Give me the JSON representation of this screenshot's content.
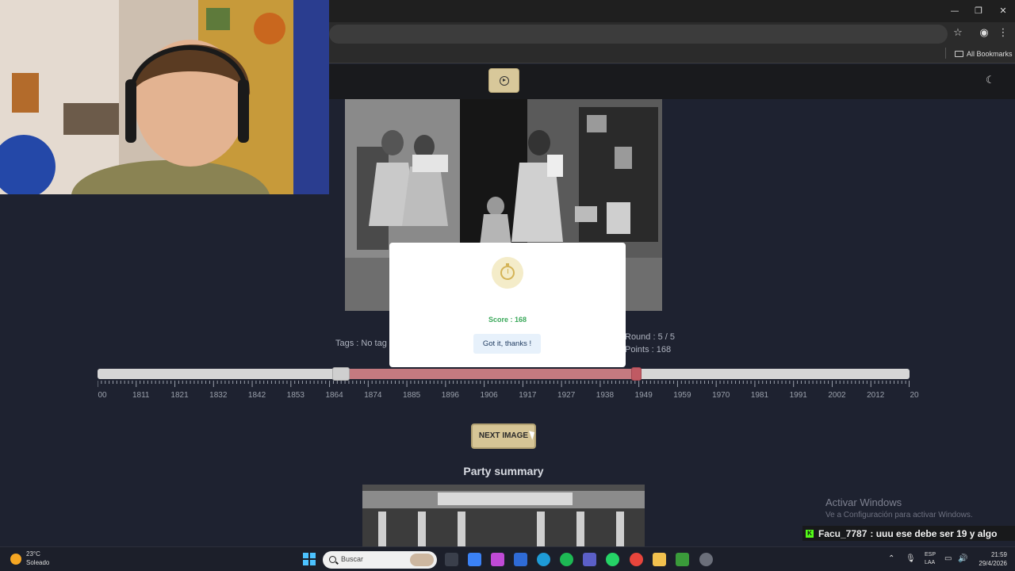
{
  "browser": {
    "bookmarks_label": "All Bookmarks",
    "controls": {
      "minimize": "—",
      "restore": "❐",
      "close": "✕"
    }
  },
  "game": {
    "tags": "Tags : No tag",
    "round": "Round : 5 / 5",
    "points": "Points : 168",
    "timeline_ticks": [
      "00",
      "1811",
      "1821",
      "1832",
      "1842",
      "1853",
      "1864",
      "1874",
      "1885",
      "1896",
      "1906",
      "1917",
      "1927",
      "1938",
      "1949",
      "1959",
      "1970",
      "1981",
      "1991",
      "2002",
      "2012",
      "20"
    ],
    "range_start_fraction": 0.3,
    "range_end_fraction": 0.663,
    "next_label": "NEXT IMAGE",
    "summary_title": "Party summary"
  },
  "modal": {
    "score": "Score : 168",
    "button": "Got it, thanks !"
  },
  "activation": {
    "title": "Activar Windows",
    "subtitle": "Ve a Configuración para activar Windows."
  },
  "chat": {
    "user": "Facu_7787",
    "message": ": uuu ese debe ser 19 y algo"
  },
  "taskbar": {
    "temperature": "23°C",
    "condition": "Soleado",
    "search_placeholder": "Buscar",
    "lang_1": "ESP",
    "lang_2": "LAA",
    "time": "21:59",
    "date": "29/4/2026"
  },
  "colors": {
    "page_bg": "#1e2230",
    "accent_button": "#d6c596",
    "range_fill": "#c57a80",
    "score_green": "#3aa85a"
  }
}
